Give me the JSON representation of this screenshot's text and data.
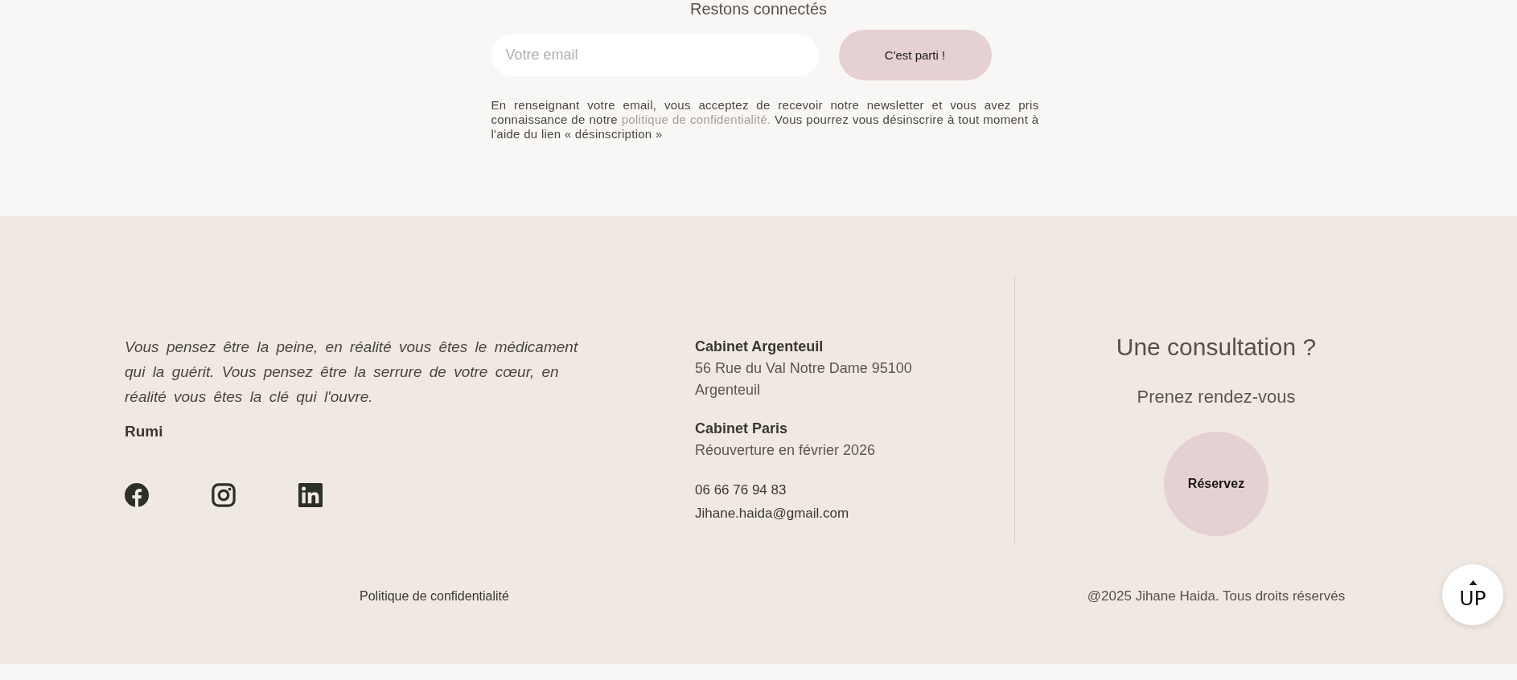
{
  "newsletter": {
    "heading": "Restons connectés",
    "email_field": {
      "placeholder": "Votre email"
    },
    "submit_button": "C'est parti !",
    "consent": {
      "text_before": "En renseignant votre email, vous acceptez de recevoir notre newsletter et vous avez pris connaissance de notre ",
      "link": "politique de confidentialité.",
      "text_after": " Vous pourrez vous désinscrire à tout moment à l'aide du lien « désinscription »"
    }
  },
  "footer": {
    "quote": {
      "text": "Vous pensez être la peine, en réalité vous êtes le médicament qui la guérit. Vous pensez être la serrure de votre cœur, en réalité vous êtes la clé qui l'ouvre.",
      "author": "Rumi"
    },
    "social_links": [
      {
        "kind": "facebook"
      },
      {
        "kind": "instagram"
      },
      {
        "kind": "linkedin"
      }
    ],
    "offices": [
      {
        "name": "Cabinet Argenteuil",
        "detail": "56 Rue du Val Notre Dame 95100 Argenteuil"
      },
      {
        "name": "Cabinet Paris",
        "detail": "Réouverture en février 2026"
      }
    ],
    "contact": {
      "phone": "06 66 76 94 83",
      "email": "Jihane.haida@gmail.com"
    },
    "booking": {
      "title": "Une consultation ?",
      "subtitle": "Prenez rendez-vous",
      "button": "Réservez"
    },
    "privacy_link": "Politique de confidentialité",
    "copyright": "@2025 Jihane Haida. Tous droits réservés"
  },
  "back_to_top": {
    "label": "UP"
  }
}
